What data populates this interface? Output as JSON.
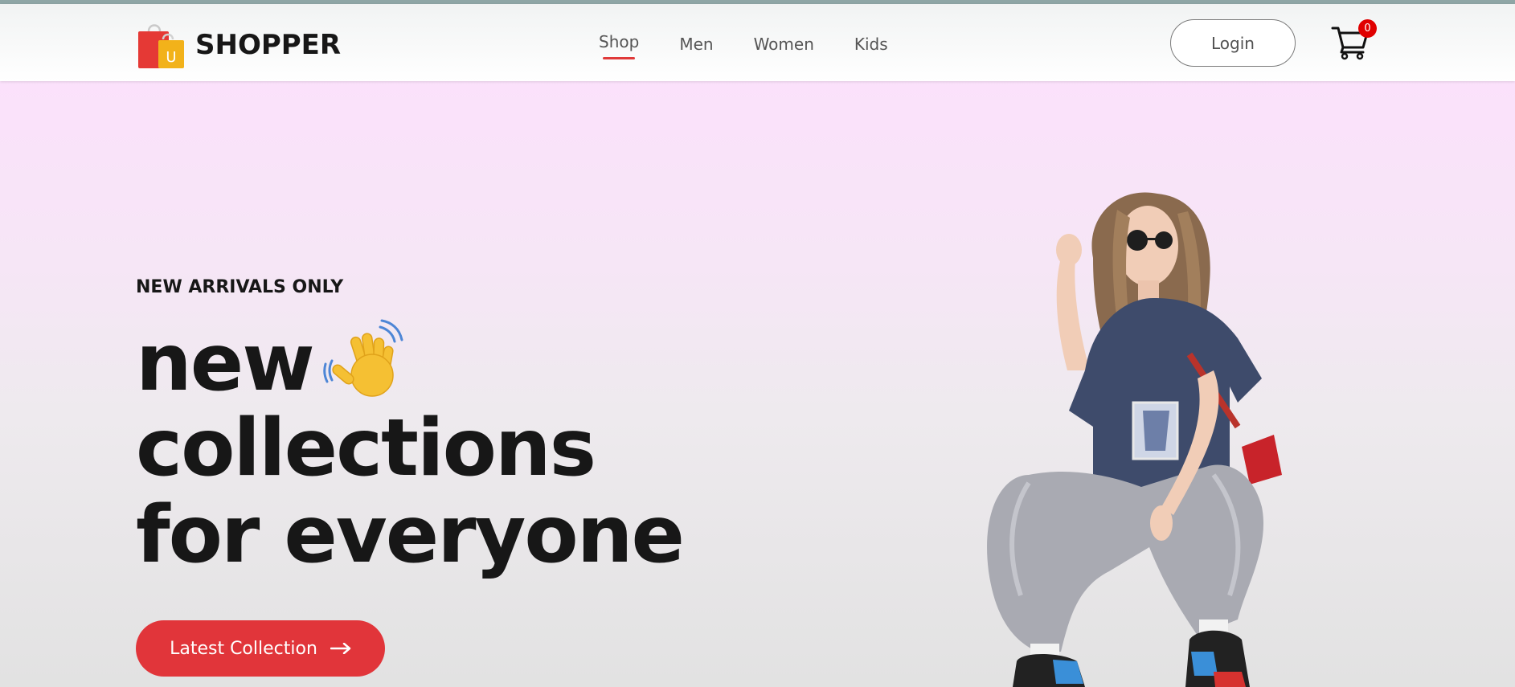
{
  "brand": {
    "name": "SHOPPER",
    "logo_letter": "U",
    "colors": {
      "bag_red": "#e53935",
      "bag_yellow": "#f2b21a"
    }
  },
  "nav": {
    "items": [
      {
        "label": "Shop",
        "active": true
      },
      {
        "label": "Men",
        "active": false
      },
      {
        "label": "Women",
        "active": false
      },
      {
        "label": "Kids",
        "active": false
      }
    ],
    "accent_color": "#e03a3a"
  },
  "header": {
    "login_label": "Login",
    "cart_icon": "cart-icon",
    "cart_count": "0"
  },
  "hero": {
    "eyebrow": "NEW ARRIVALS ONLY",
    "headline": [
      "new",
      "collections",
      "for everyone"
    ],
    "hand_icon": "waving-hand-icon",
    "cta_label": "Latest Collection",
    "cta_icon": "arrow-right-icon",
    "cta_color": "#e1353a",
    "image": "hero-model-image"
  }
}
